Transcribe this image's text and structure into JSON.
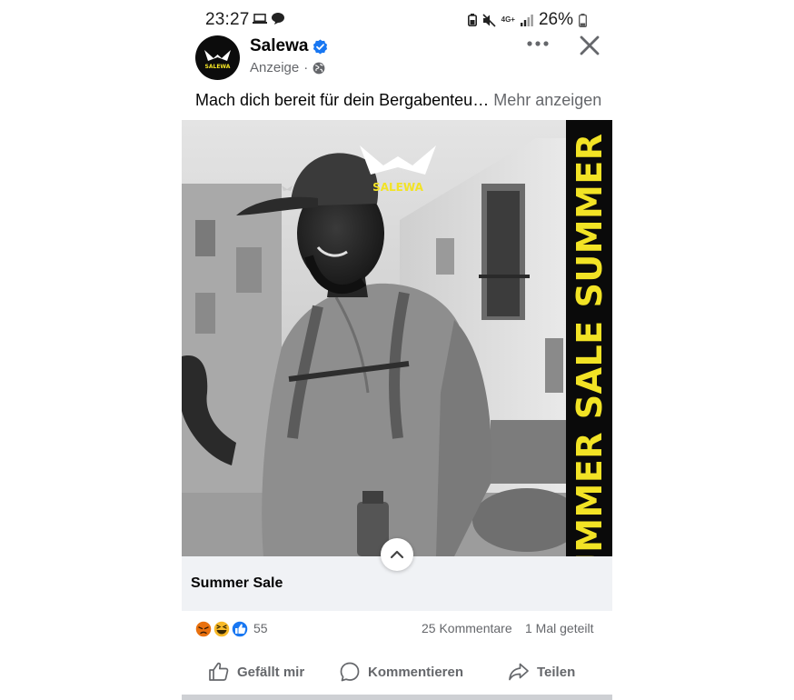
{
  "status_bar": {
    "time": "23:27",
    "network": "4G+",
    "battery": "26%",
    "icons": [
      "laptop-icon",
      "chat-bubble-icon",
      "battery-saver-icon",
      "mute-icon",
      "signal-icon",
      "battery-icon"
    ]
  },
  "post": {
    "brand_name": "Salewa",
    "avatar_text": "SALEWA",
    "verified": true,
    "sponsored_label": "Anzeige",
    "separator": "·",
    "audience_icon": "globe-icon",
    "caption": "Mach dich bereit für dein Bergabenteu…",
    "see_more": "Mehr anzeigen",
    "image": {
      "logo_text": "SALEWA",
      "band_text": "UMMER SALE SUMMER S",
      "band_color": "#f2e325"
    },
    "ad_title": "Summer Sale"
  },
  "engagement": {
    "reaction_icons": [
      "angry-icon",
      "haha-icon",
      "like-icon"
    ],
    "reaction_count": "55",
    "comments": "25 Kommentare",
    "shares": "1 Mal geteilt"
  },
  "actions": {
    "like": "Gefällt mir",
    "comment": "Kommentieren",
    "share": "Teilen"
  },
  "colors": {
    "verified_blue": "#1877f2",
    "secondary_text": "#65676b",
    "ad_footer_bg": "#f0f2f5",
    "brand_yellow": "#f2e325"
  }
}
